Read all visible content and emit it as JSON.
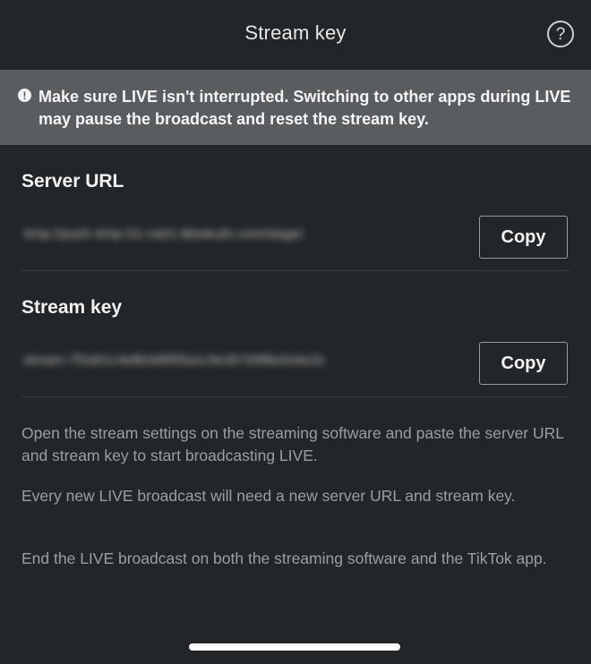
{
  "header": {
    "title": "Stream key",
    "help_icon": "?"
  },
  "banner": {
    "icon": "!",
    "message": "Make sure LIVE isn't interrupted. Switching to other apps during LIVE may pause the broadcast and reset the stream key."
  },
  "server_url": {
    "label": "Server URL",
    "value": "rtmp://push-rtmp-l11-va01.tiktokcdn.com/stage/",
    "copy_label": "Copy"
  },
  "stream_key": {
    "label": "Stream key",
    "value": "stream-7f2a91c4e8b3d6f05a1c9e2b7d4f8a3c6e1b",
    "copy_label": "Copy"
  },
  "instructions": [
    "Open the stream settings on the streaming software and paste the server URL and stream key to start broadcasting LIVE.",
    "Every new LIVE broadcast will need a new server URL and stream key.",
    "End the LIVE broadcast on both the streaming software and the TikTok app."
  ],
  "colors": {
    "background": "#232628",
    "banner": "#5a5d60",
    "text_primary": "#f2f2f2",
    "text_secondary": "#9c9fa2"
  }
}
